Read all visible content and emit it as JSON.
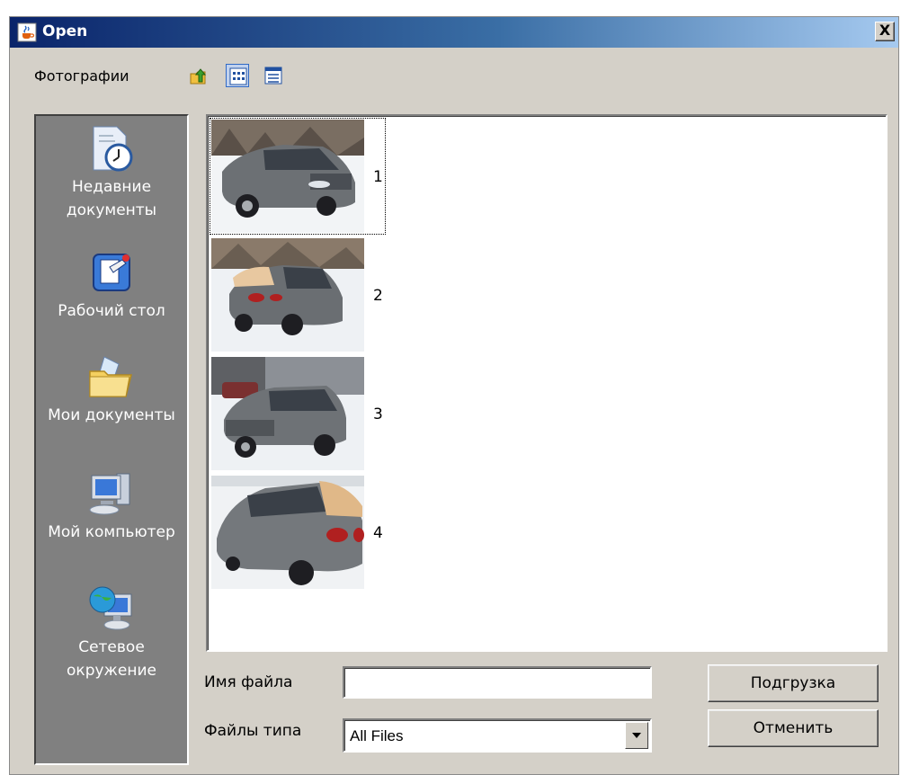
{
  "window": {
    "title": "Open",
    "close_label": "X"
  },
  "toolbar": {
    "look_in_label": "Фотографии",
    "up_icon": "up-folder-icon",
    "list_view_icon": "list-view-icon",
    "details_view_icon": "details-view-icon"
  },
  "places": [
    {
      "label": "Недавние документы",
      "icon": "recent-documents-icon"
    },
    {
      "label": "Рабочий стол",
      "icon": "desktop-icon"
    },
    {
      "label": "Мои документы",
      "icon": "my-documents-icon"
    },
    {
      "label": "Мой компьютер",
      "icon": "my-computer-icon"
    },
    {
      "label": "Сетевое окружение",
      "icon": "network-icon"
    }
  ],
  "files": [
    {
      "name": "1",
      "selected": true
    },
    {
      "name": "2",
      "selected": false
    },
    {
      "name": "3",
      "selected": false
    },
    {
      "name": "4",
      "selected": false
    }
  ],
  "form": {
    "filename_label": "Имя файла",
    "filename_value": "",
    "filetype_label": "Файлы типа",
    "filetype_value": "All Files"
  },
  "buttons": {
    "load": "Подгрузка",
    "cancel": "Отменить"
  },
  "colors": {
    "titlebar_start": "#0a246a",
    "titlebar_end": "#a6caf0",
    "dialog_bg": "#d4d0c8",
    "places_bg": "#808080"
  }
}
